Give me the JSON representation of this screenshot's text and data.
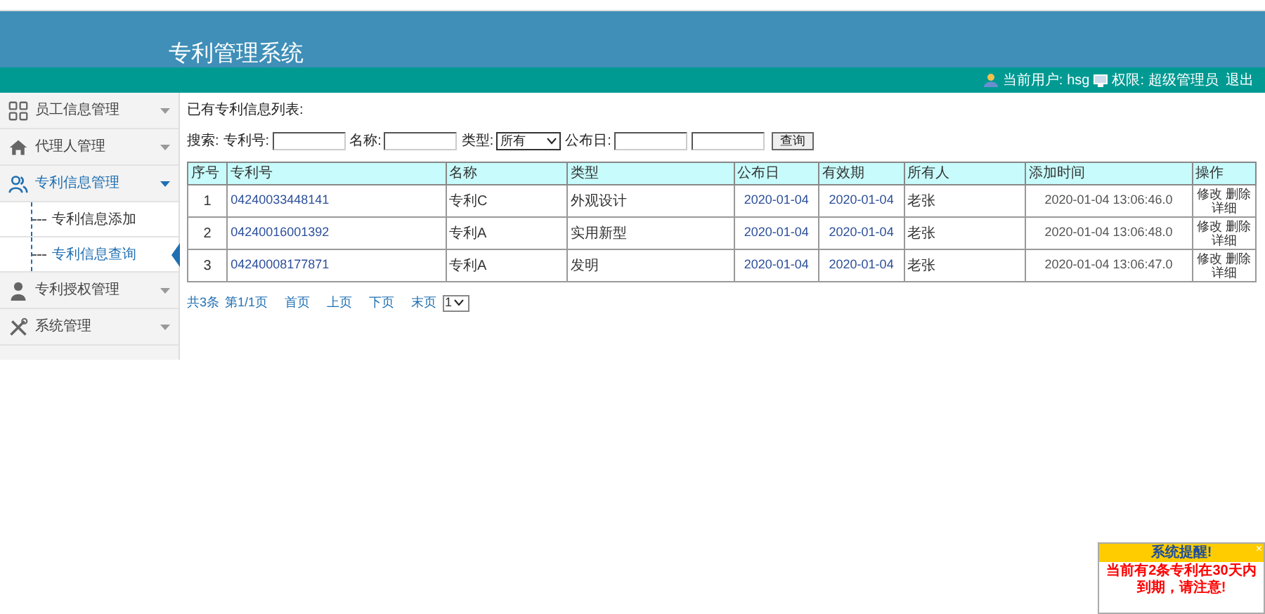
{
  "header": {
    "title": "专利管理系统",
    "user_label": "当前用户:",
    "user": "hsg",
    "role_label": "权限:",
    "role": "超级管理员",
    "logout": "退出"
  },
  "sidebar": {
    "items": [
      {
        "label": "员工信息管理",
        "kind": "grid",
        "expanded": false
      },
      {
        "label": "代理人管理",
        "kind": "home",
        "expanded": false
      },
      {
        "label": "专利信息管理",
        "kind": "users",
        "expanded": true,
        "children": [
          {
            "label": "专利信息添加",
            "selected": false
          },
          {
            "label": "专利信息查询",
            "selected": true
          }
        ]
      },
      {
        "label": "专利授权管理",
        "kind": "user",
        "expanded": false
      },
      {
        "label": "系统管理",
        "kind": "tools",
        "expanded": false
      }
    ]
  },
  "content": {
    "heading": "已有专利信息列表:",
    "search": {
      "label": "搜索:",
      "fields": [
        {
          "kind": "text",
          "label": "专利号:"
        },
        {
          "kind": "text",
          "label": "名称:"
        },
        {
          "kind": "select",
          "label": "类型:",
          "value": "所有"
        },
        {
          "kind": "text",
          "label": "公布日:"
        },
        {
          "kind": "text"
        }
      ],
      "button": "查询"
    },
    "table": {
      "columns": [
        "序号",
        "专利号",
        "名称",
        "类型",
        "公布日",
        "有效期",
        "所有人",
        "添加时间",
        "操作"
      ],
      "rows": [
        {
          "cells": [
            "1",
            "04240033448141",
            "专利C",
            "外观设计",
            "2020-01-04",
            "2020-01-04",
            "老张",
            "2020-01-04 13:06:46.0"
          ],
          "actions": [
            "修改",
            "删除",
            "详细"
          ]
        },
        {
          "cells": [
            "2",
            "04240016001392",
            "专利A",
            "实用新型",
            "2020-01-04",
            "2020-01-04",
            "老张",
            "2020-01-04 13:06:48.0"
          ],
          "actions": [
            "修改",
            "删除",
            "详细"
          ]
        },
        {
          "cells": [
            "3",
            "04240008177871",
            "专利A",
            "发明",
            "2020-01-04",
            "2020-01-04",
            "老张",
            "2020-01-04 13:06:47.0"
          ],
          "actions": [
            "修改",
            "删除",
            "详细"
          ]
        }
      ]
    },
    "pagination": {
      "total": "共3条",
      "page": "第1/1页",
      "links": [
        "首页",
        "上页",
        "下页",
        "末页"
      ],
      "select": "1"
    }
  },
  "popup": {
    "title": "系统提醒!",
    "close": "×",
    "message": "当前有2条专利在30天内到期，请注意!"
  }
}
